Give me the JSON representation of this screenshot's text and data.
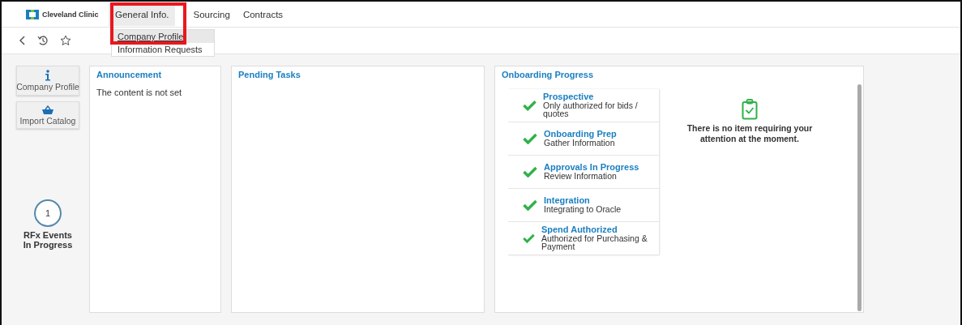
{
  "header": {
    "logo": "Cleveland Clinic",
    "menu": [
      {
        "label": "General Info.",
        "selected": true
      },
      {
        "label": "Sourcing",
        "selected": false
      },
      {
        "label": "Contracts",
        "selected": false
      }
    ]
  },
  "dropdown": {
    "items": [
      {
        "label": "Company Profile",
        "selected": true
      },
      {
        "label": "Information Requests",
        "selected": false
      }
    ]
  },
  "sidebar": {
    "buttons": [
      {
        "kind": "info",
        "label": "Company Profile"
      },
      {
        "kind": "basket",
        "label": "Import Catalog"
      }
    ],
    "counter": {
      "count": "1",
      "label": "RFx Events In Progress"
    }
  },
  "announcement": {
    "title": "Announcement",
    "text": "The content is not set"
  },
  "pending_tasks": {
    "title": "Pending Tasks"
  },
  "onboarding": {
    "title": "Onboarding Progress",
    "steps": [
      {
        "name": "Prospective",
        "description": "Only authorized for bids / quotes",
        "done": true
      },
      {
        "name": "Onboarding Prep",
        "description": "Gather Information",
        "done": true
      },
      {
        "name": "Approvals In Progress",
        "description": "Review Information",
        "done": true
      },
      {
        "name": "Integration",
        "description": "Integrating to Oracle",
        "done": true
      },
      {
        "name": "Spend Authorized",
        "description": "Authorized for Purchasing & Payment",
        "done": true
      }
    ],
    "message": "There is no item requiring your attention at the moment."
  }
}
